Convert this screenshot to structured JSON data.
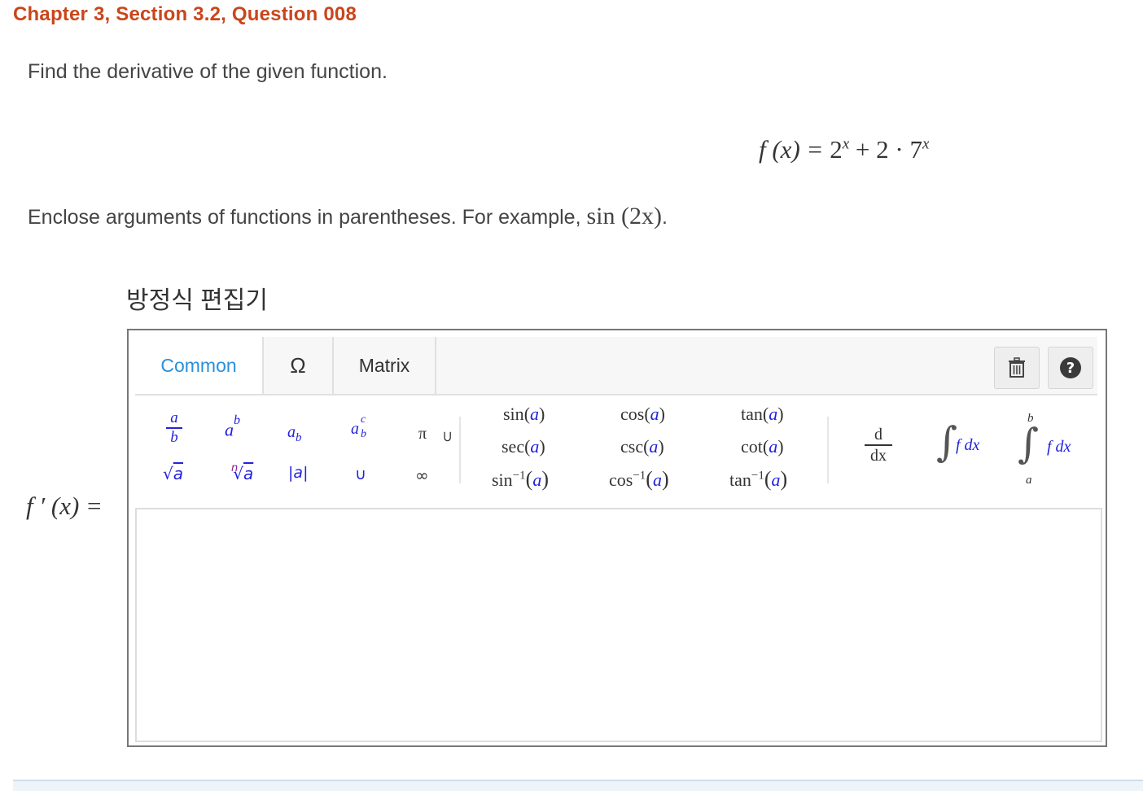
{
  "header": {
    "title": "Chapter 3, Section 3.2, Question 008"
  },
  "question": {
    "prompt": "Find the derivative of the given function.",
    "function_lhs": "f (x) = ",
    "base1": "2",
    "exp1": "x",
    "plus": " + 2 · ",
    "base2": "7",
    "exp2": "x",
    "instruction": "Enclose arguments of functions in parentheses. For example, ",
    "example": "sin (2x)",
    "period": "."
  },
  "editor": {
    "title": "방정식 편집기",
    "tabs": [
      {
        "label": "Common",
        "active": true
      },
      {
        "label": "Ω",
        "active": false
      },
      {
        "label": "Matrix",
        "active": false
      }
    ],
    "palette": {
      "pi": "π",
      "infinity": "∞",
      "union": "∪",
      "superset": "⊃",
      "abs_bars": "|",
      "trig": [
        {
          "name": "sin",
          "arg": "a"
        },
        {
          "name": "cos",
          "arg": "a"
        },
        {
          "name": "tan",
          "arg": "a"
        },
        {
          "name": "sec",
          "arg": "a"
        },
        {
          "name": "csc",
          "arg": "a"
        },
        {
          "name": "cot",
          "arg": "a"
        }
      ],
      "inverse_trig": [
        {
          "name": "sin",
          "arg": "a"
        },
        {
          "name": "cos",
          "arg": "a"
        },
        {
          "name": "tan",
          "arg": "a"
        }
      ],
      "inverse_sup": "−1",
      "deriv_num": "d",
      "deriv_den": "dx",
      "integral_body": "f dx",
      "upper_limit": "b",
      "lower_limit": "a",
      "var_a": "a",
      "var_b": "b",
      "var_c": "c",
      "var_n": "n"
    },
    "answer_label": "f ′ (x) ="
  },
  "colors": {
    "accent": "#2a90d9",
    "title": "#c9461b",
    "variable": "#2222dd",
    "purple": "#8a1e8a"
  }
}
